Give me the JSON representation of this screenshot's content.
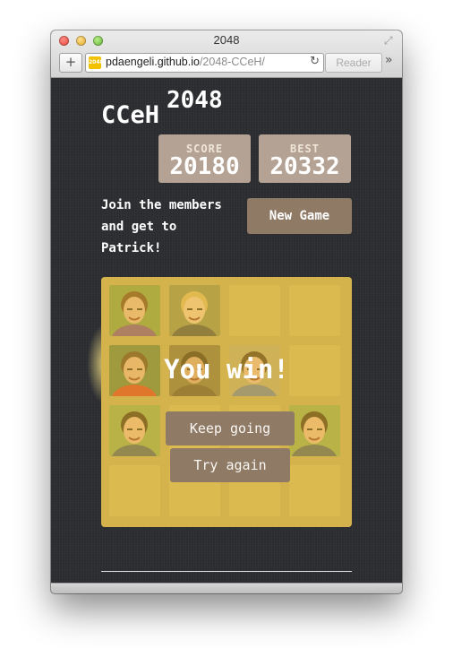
{
  "window": {
    "title": "2048",
    "url_host": "pdaengeli.github.io",
    "url_path": "/2048-CCeH/",
    "add_tab_label": "+",
    "reader_label": "Reader",
    "favicon_text": "2048",
    "reload_icon": "reload-icon",
    "overflow_icon": "»",
    "fullscreen_icon": "⤢"
  },
  "game": {
    "title": "CCeH",
    "title_sup": "2048",
    "score_label": "SCORE",
    "score_value": "20180",
    "best_label": "BEST",
    "best_value": "20332",
    "intro": "Join the members and get to Patrick!",
    "new_game_label": "New Game",
    "message": "You win!",
    "keep_going_label": "Keep going",
    "try_again_label": "Try again"
  },
  "board": {
    "rows": [
      [
        "woman-dark-hair",
        "woman-blonde",
        "",
        ""
      ],
      [
        "man-red-shirt",
        "man-beard",
        "man-glasses",
        ""
      ],
      [
        "patrick",
        "",
        "",
        "patrick"
      ],
      [
        "",
        "",
        "",
        ""
      ]
    ]
  },
  "colors": {
    "board": "#bfa865",
    "button": "#8f7a66",
    "score_box": "#b4a294",
    "page_bg": "#2c2e32",
    "win_overlay": "#edc22e"
  }
}
